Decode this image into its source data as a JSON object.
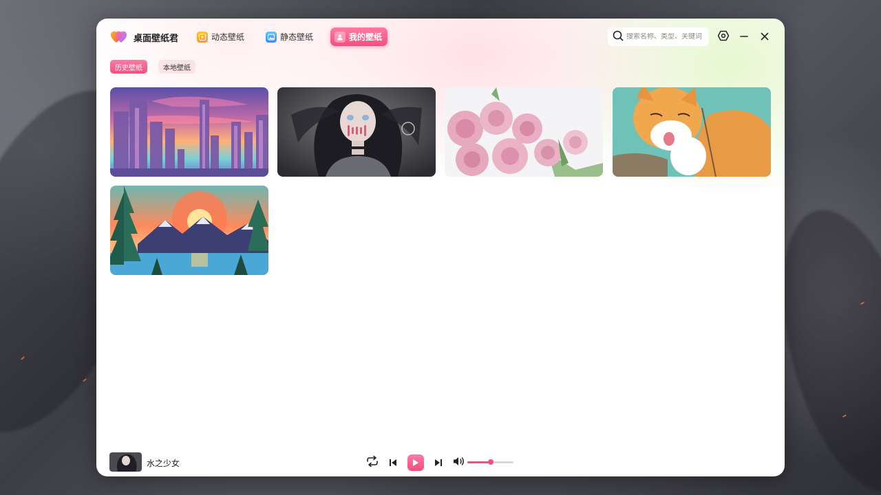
{
  "app": {
    "title": "桌面壁纸君"
  },
  "nav": {
    "tabs": [
      {
        "label": "动态壁纸",
        "icon": "video-play-icon",
        "active": false
      },
      {
        "label": "静态壁纸",
        "icon": "image-icon",
        "active": false
      },
      {
        "label": "我的壁纸",
        "icon": "user-icon",
        "active": true
      }
    ]
  },
  "search": {
    "placeholder": "搜索名称、类型、关键词",
    "value": ""
  },
  "window_controls": {
    "settings": "settings-icon",
    "minimize": "minimize-icon",
    "close": "close-icon"
  },
  "sub_tabs": [
    {
      "label": "历史壁纸",
      "active": true
    },
    {
      "label": "本地壁纸",
      "active": false
    }
  ],
  "wallpapers": [
    {
      "subject": "pixel-art city skyline at sunset",
      "playing": false
    },
    {
      "subject": "anime girl with dark hair",
      "playing": true
    },
    {
      "subject": "pink roses",
      "playing": false
    },
    {
      "subject": "orange cat licking paw",
      "playing": false
    },
    {
      "subject": "sunset over mountains and lake",
      "playing": false
    }
  ],
  "player": {
    "now_playing": "水之少女",
    "volume_percent": 50,
    "icons": [
      "repeat-icon",
      "previous-icon",
      "play-icon",
      "next-icon",
      "volume-icon"
    ]
  },
  "colors": {
    "accent": "#f2507f",
    "accent_light": "#ff7aa6",
    "sub_tab_inactive": "#fbe3e8"
  }
}
